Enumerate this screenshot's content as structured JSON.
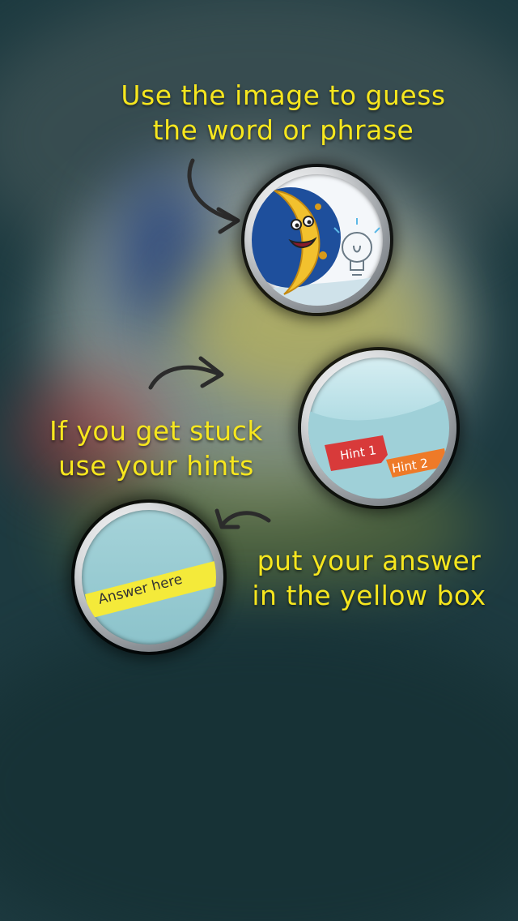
{
  "tutorial": {
    "step1": {
      "line1": "Use the image to guess",
      "line2": "the word or phrase"
    },
    "step2": {
      "line1": "If you get stuck",
      "line2": "use your hints"
    },
    "step3": {
      "line1": "put your answer",
      "line2": "in the yellow box"
    }
  },
  "illustrations": {
    "hint1_label": "Hint 1",
    "hint2_label": "Hint 2",
    "answer_label": "Answer here"
  },
  "colors": {
    "background": "#1d3a40",
    "caption": "#f6e61e",
    "hint1": "#d83a3a",
    "hint2": "#ee7a28",
    "answer_strip": "#f4ea3a"
  }
}
